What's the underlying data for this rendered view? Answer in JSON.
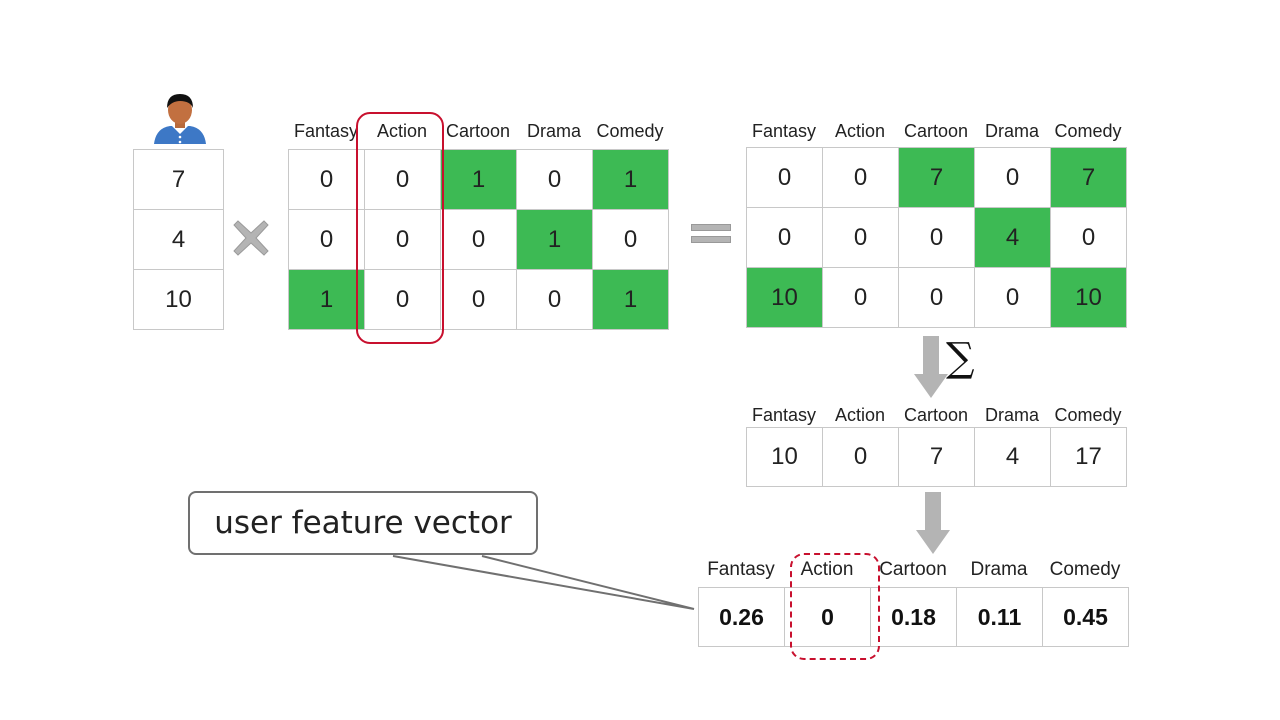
{
  "user_vector": {
    "icon": "user-avatar-icon",
    "values": [
      "7",
      "4",
      "10"
    ]
  },
  "operators": {
    "multiply": "multiply-icon",
    "equals": "equals-icon",
    "sum_symbol": "∑"
  },
  "genres": [
    "Fantasy",
    "Action",
    "Cartoon",
    "Drama",
    "Comedy"
  ],
  "movie_matrix": {
    "rows": [
      [
        "0",
        "0",
        "1",
        "0",
        "1"
      ],
      [
        "0",
        "0",
        "0",
        "1",
        "0"
      ],
      [
        "1",
        "0",
        "0",
        "0",
        "1"
      ]
    ],
    "highlight": [
      [
        false,
        false,
        true,
        false,
        true
      ],
      [
        false,
        false,
        false,
        true,
        false
      ],
      [
        true,
        false,
        false,
        false,
        true
      ]
    ],
    "circled_column": "Action"
  },
  "weighted_matrix": {
    "rows": [
      [
        "0",
        "0",
        "7",
        "0",
        "7"
      ],
      [
        "0",
        "0",
        "0",
        "4",
        "0"
      ],
      [
        "10",
        "0",
        "0",
        "0",
        "10"
      ]
    ],
    "highlight": [
      [
        false,
        false,
        true,
        false,
        true
      ],
      [
        false,
        false,
        false,
        true,
        false
      ],
      [
        true,
        false,
        false,
        false,
        true
      ]
    ]
  },
  "sum_vector": [
    "10",
    "0",
    "7",
    "4",
    "17"
  ],
  "normalized_vector": {
    "values": [
      "0.26",
      "0",
      "0.18",
      "0.11",
      "0.45"
    ],
    "circled_column": "Action"
  },
  "callout": {
    "label": "user feature vector"
  },
  "colors": {
    "highlight_green": "#3dba54",
    "circle_red": "#c8102e",
    "operator_gray": "#b4b4b4"
  }
}
